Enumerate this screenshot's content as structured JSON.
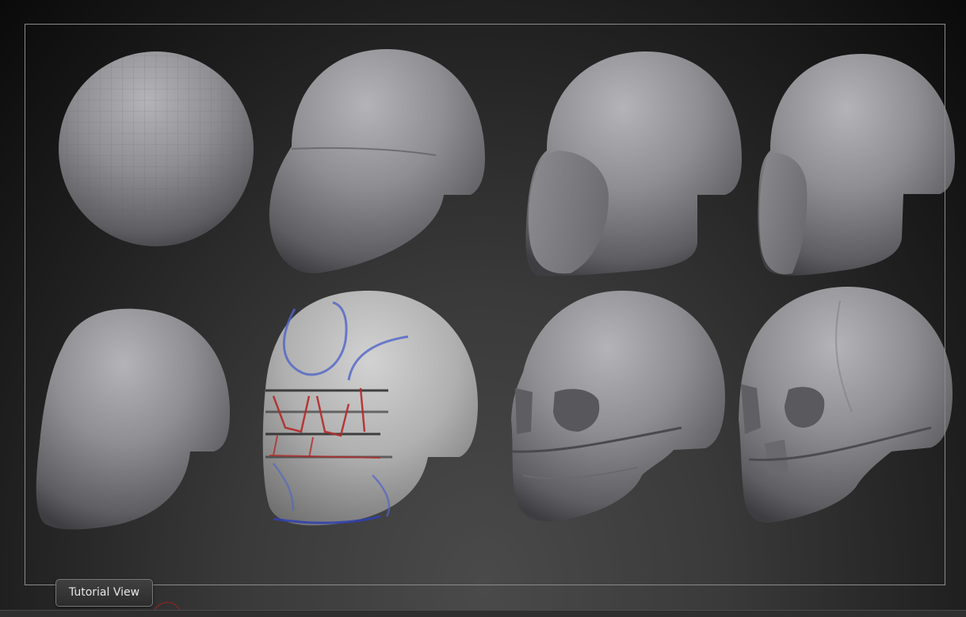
{
  "toolbar": {
    "tutorial_view_label": "Tutorial View"
  },
  "colors": {
    "background": "#1a1a1a",
    "clay": "#8c8c8c",
    "frame": "#8a8a8a",
    "guide_red": "#b42a2a",
    "guide_blue": "#4a5bc8"
  },
  "stages": [
    {
      "name": "sphere"
    },
    {
      "name": "cranium-jaw-blockout"
    },
    {
      "name": "face-plane-blockout"
    },
    {
      "name": "refined-blockout"
    },
    {
      "name": "smoothed-head"
    },
    {
      "name": "guide-lines-drawn"
    },
    {
      "name": "carved-skull"
    },
    {
      "name": "detailed-skull"
    }
  ]
}
